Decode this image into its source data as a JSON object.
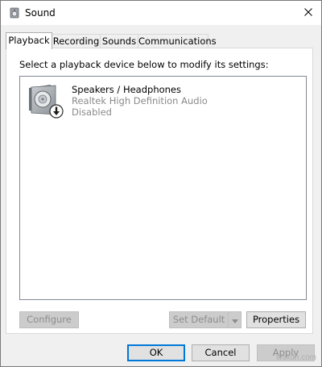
{
  "window": {
    "title": "Sound",
    "app_icon": "speaker-icon",
    "close_icon": "close-icon"
  },
  "tabs": [
    {
      "label": "Playback",
      "active": true
    },
    {
      "label": "Recording",
      "active": false
    },
    {
      "label": "Sounds",
      "active": false
    },
    {
      "label": "Communications",
      "active": false
    }
  ],
  "panel": {
    "instruction": "Select a playback device below to modify its settings:",
    "devices": [
      {
        "name": "Speakers / Headphones",
        "driver": "Realtek High Definition Audio",
        "status": "Disabled",
        "icon": "speaker-device-icon",
        "status_icon": "down-arrow-badge-icon"
      }
    ],
    "buttons": {
      "configure": "Configure",
      "set_default": "Set Default",
      "set_default_arrow_icon": "dropdown-arrow-icon",
      "properties": "Properties"
    }
  },
  "footer": {
    "ok": "OK",
    "cancel": "Cancel",
    "apply": "Apply"
  },
  "watermark": "wsxdn.com",
  "colors": {
    "focus_border": "#0078d7",
    "disabled_text": "#8c8c8c",
    "secondary_text": "#8a8a8a"
  }
}
